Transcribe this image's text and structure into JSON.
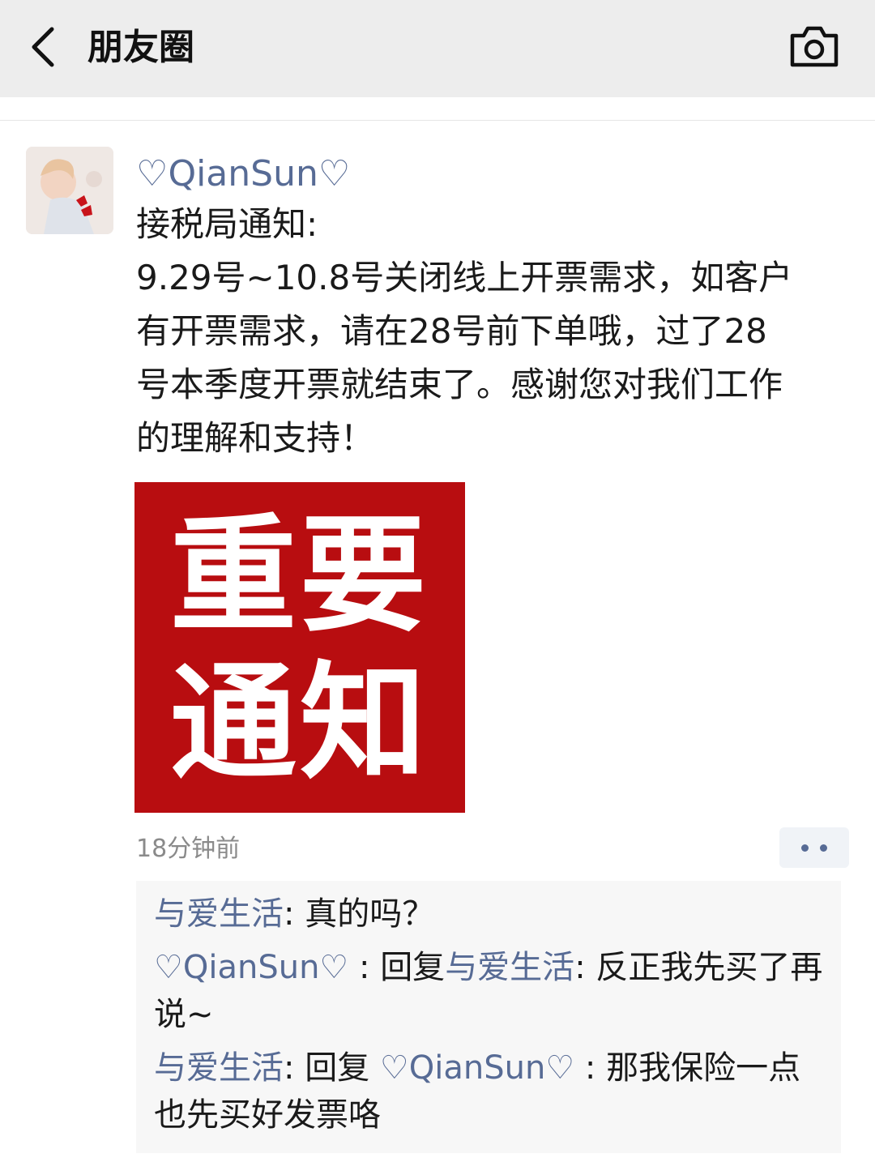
{
  "header": {
    "title": "朋友圈",
    "back_icon": "chevron-left-icon",
    "camera_icon": "camera-icon"
  },
  "post": {
    "author": "♡QianSun♡",
    "lines": [
      "接税局通知:",
      "9.29号~10.8号关闭线上开票需求，如客户",
      "有开票需求，请在28号前下单哦，过了28",
      "号本季度开票就结束了。感谢您对我们工作",
      "的理解和支持！"
    ],
    "image": {
      "line1": "重要",
      "line2": "通知",
      "bg_color": "#b80d10"
    },
    "timestamp": "18分钟前"
  },
  "comments": {
    "c1": {
      "name": "与爱生活",
      "sep": ": ",
      "text": "真的吗？"
    },
    "c2": {
      "name": "♡QianSun♡",
      "reply_prefix": " : 回复",
      "reply_to": "与爱生活",
      "sep": ": ",
      "text": "反正我先买了再说~"
    },
    "c3": {
      "name": "与爱生活",
      "reply_prefix": ": 回复 ",
      "reply_to": "♡QianSun♡",
      "sep": " : ",
      "text": "那我保险一点也先买好发票咯"
    }
  },
  "colors": {
    "link": "#576b95",
    "header_bg": "#ededed",
    "comment_bg": "#f7f7f7"
  }
}
